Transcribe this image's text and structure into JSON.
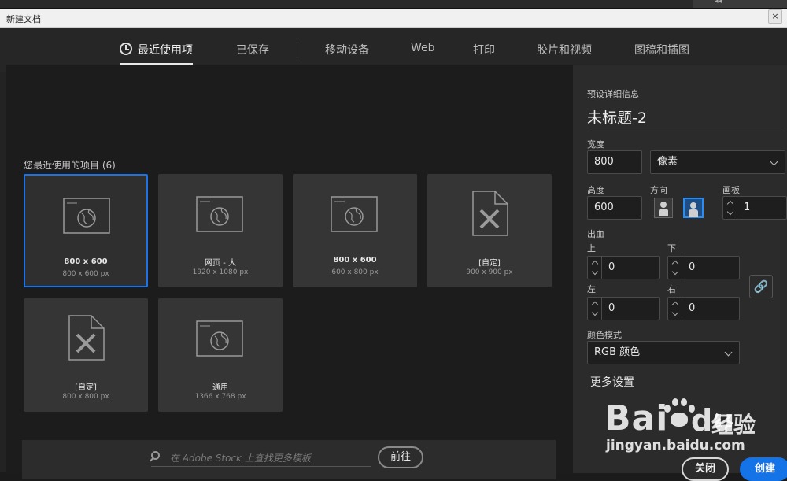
{
  "window": {
    "title": "新建文档",
    "close_glyph": "×"
  },
  "top_grip": "◂◂",
  "tabs": [
    {
      "label": "最近使用项",
      "active": true
    },
    {
      "label": "已保存"
    },
    {
      "label": "移动设备"
    },
    {
      "label": "Web"
    },
    {
      "label": "打印"
    },
    {
      "label": "胶片和视频"
    },
    {
      "label": "图稿和插图"
    }
  ],
  "recent": {
    "title": "您最近使用的项目",
    "count": "(6)",
    "items": [
      {
        "name": "800 x 600",
        "dims": "800 x 600 px",
        "icon": "web-globe-icon",
        "selected": true
      },
      {
        "name": "网页 - 大",
        "dims": "1920 x 1080 px",
        "icon": "web-globe-icon"
      },
      {
        "name": "800 x 600",
        "dims": "600 x 800 px",
        "icon": "web-globe-icon"
      },
      {
        "name": "[自定]",
        "dims": "900 x 900 px",
        "icon": "document-pencil-icon"
      },
      {
        "name": "[自定]",
        "dims": "800 x 800 px",
        "icon": "document-pencil-icon"
      },
      {
        "name": "通用",
        "dims": "1366 x 768 px",
        "icon": "web-globe-icon"
      }
    ]
  },
  "stock": {
    "placeholder": "在 Adobe Stock 上查找更多模板",
    "go_label": "前往"
  },
  "panel": {
    "section_title": "预设详细信息",
    "doc_name": "未标题-2",
    "width_label": "宽度",
    "width_value": "800",
    "unit": "像素",
    "height_label": "高度",
    "height_value": "600",
    "orientation_label": "方向",
    "artboard_label": "画板",
    "artboard_value": "1",
    "bleed_label": "出血",
    "top_label": "上",
    "top_value": "0",
    "bottom_label": "下",
    "bottom_value": "0",
    "left_label": "左",
    "left_value": "0",
    "right_label": "右",
    "right_value": "0",
    "color_mode_label": "颜色模式",
    "color_mode_value": "RGB 颜色",
    "more_settings": "更多设置",
    "close_label": "关闭",
    "create_label": "创建"
  },
  "watermark": {
    "brand": "Bai",
    "brand2": "du",
    "cn": "经验",
    "url": "jingyan.baidu.com"
  }
}
